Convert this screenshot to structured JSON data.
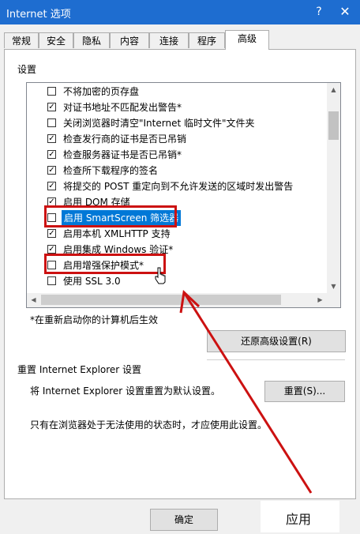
{
  "window": {
    "title": "Internet 选项",
    "help_glyph": "?",
    "close_glyph": "✕",
    "titlebar_color": "#1e6dd0"
  },
  "tabs": [
    {
      "label": "常规"
    },
    {
      "label": "安全"
    },
    {
      "label": "隐私"
    },
    {
      "label": "内容"
    },
    {
      "label": "连接"
    },
    {
      "label": "程序"
    },
    {
      "label": "高级",
      "active": true
    }
  ],
  "settings": {
    "group_label": "设置",
    "items": [
      {
        "label": "不将加密的页存盘",
        "checked": false
      },
      {
        "label": "对证书地址不匹配发出警告*",
        "checked": true
      },
      {
        "label": "关闭浏览器时清空\"Internet 临时文件\"文件夹",
        "checked": false
      },
      {
        "label": "检查发行商的证书是否已吊销",
        "checked": true
      },
      {
        "label": "检查服务器证书是否已吊销*",
        "checked": true
      },
      {
        "label": "检查所下载程序的签名",
        "checked": true
      },
      {
        "label": "将提交的 POST 重定向到不允许发送的区域时发出警告",
        "checked": true
      },
      {
        "label": "启用 DOM 存储",
        "checked": true
      },
      {
        "label": "启用 SmartScreen 筛选器",
        "checked": false,
        "selected": true
      },
      {
        "label": "启用本机 XMLHTTP 支持",
        "checked": true
      },
      {
        "label": "启用集成 Windows 验证*",
        "checked": true
      },
      {
        "label": "启用增强保护模式*",
        "checked": false
      },
      {
        "label": "使用 SSL 3.0",
        "checked": false
      }
    ],
    "restart_note": "*在重新启动你的计算机后生效",
    "restore_button": "还原高级设置(R)"
  },
  "reset": {
    "group_label": "重置 Internet Explorer 设置",
    "description": "将 Internet Explorer 设置重置为默认设置。",
    "reset_button": "重置(S)...",
    "warning": "只有在浏览器处于无法使用的状态时，才应使用此设置。"
  },
  "footer": {
    "ok_button": "确定",
    "apply_label": "应用"
  },
  "annotation_color": "#cc1111"
}
